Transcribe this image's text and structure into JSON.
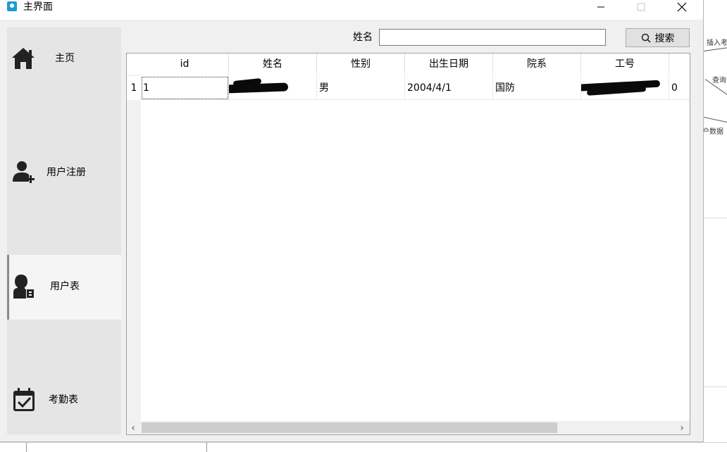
{
  "window": {
    "title": "主界面"
  },
  "sidebar": {
    "items": [
      {
        "label": "主页",
        "icon": "home-icon",
        "active": false
      },
      {
        "label": "用户注册",
        "icon": "user-add-icon",
        "active": false
      },
      {
        "label": "用户表",
        "icon": "user-list-icon",
        "active": true
      },
      {
        "label": "考勤表",
        "icon": "calendar-check-icon",
        "active": false
      }
    ]
  },
  "search": {
    "label": "姓名",
    "value": "",
    "button_label": "搜索"
  },
  "table": {
    "columns": [
      "id",
      "姓名",
      "性别",
      "出生日期",
      "院系",
      "工号"
    ],
    "rows": [
      {
        "row_number": "1",
        "id": "1",
        "gender": "男",
        "birth_date": "2004/4/1",
        "department": "国防",
        "extra": "0"
      }
    ]
  },
  "background": {
    "labels": [
      "插入考",
      "查询",
      "户数据"
    ]
  }
}
